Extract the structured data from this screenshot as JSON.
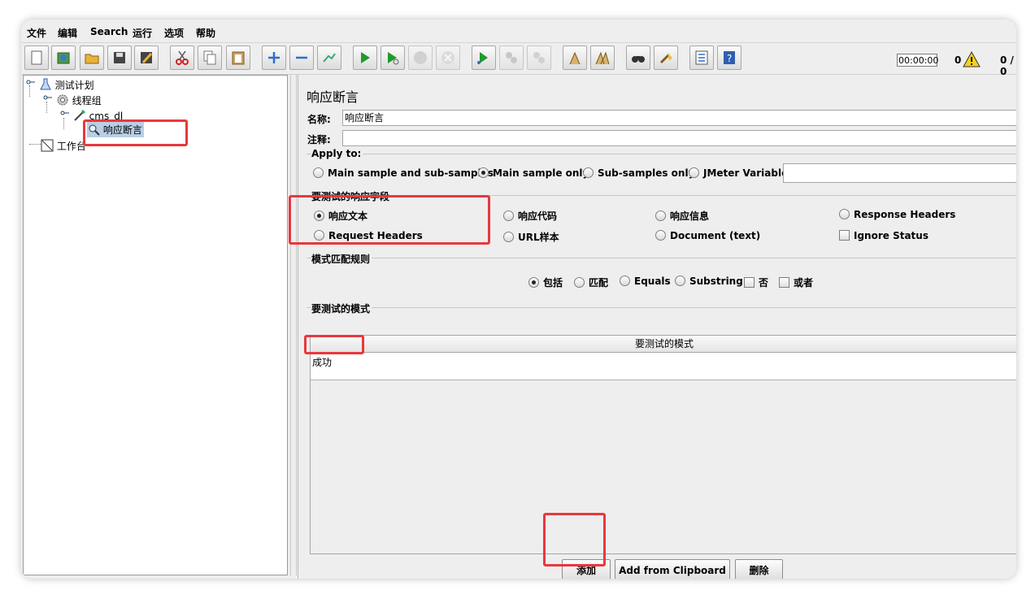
{
  "menu": [
    "文件",
    "编辑",
    "Search",
    "运行",
    "选项",
    "帮助"
  ],
  "toolbar": {
    "icons": [
      "new-icon",
      "templates-icon",
      "open-icon",
      "save-icon",
      "save-as-icon",
      "cut-icon",
      "copy-icon",
      "paste-icon",
      "expand-icon",
      "collapse-icon",
      "toggle-icon",
      "start-icon",
      "start-no-pause-icon",
      "stop-icon",
      "shutdown-icon",
      "remote-start-icon",
      "remote-stop-icon",
      "remote-shutdown-icon",
      "clear-icon",
      "clear-all-icon",
      "search-icon",
      "reset-search-icon",
      "function-helper-icon",
      "help-icon"
    ],
    "timer": "00:00:00",
    "error_count": "0",
    "thread_ratio": "0 / 0"
  },
  "tree": {
    "test_plan": "测试计划",
    "thread_group": "线程组",
    "sampler": "cms_dl",
    "assertion": "响应断言",
    "workbench": "工作台"
  },
  "panel": {
    "title": "响应断言",
    "name_label": "名称:",
    "name_value": "响应断言",
    "comment_label": "注释:",
    "comment_value": "",
    "apply_to": {
      "title": "Apply to:",
      "options": [
        "Main sample and sub-samples",
        "Main sample only",
        "Sub-samples only",
        "JMeter Variable"
      ],
      "selected": "Main sample only",
      "variable_value": ""
    },
    "field_to_test": {
      "title": "要测试的响应字段",
      "options": [
        "响应文本",
        "响应代码",
        "响应信息",
        "Response Headers",
        "Request Headers",
        "URL样本",
        "Document (text)"
      ],
      "selected": "响应文本",
      "ignore_status": "Ignore Status"
    },
    "matching_rules": {
      "title": "模式匹配规则",
      "options": [
        "包括",
        "匹配",
        "Equals",
        "Substring"
      ],
      "selected": "包括",
      "checkboxes": [
        "否",
        "或者"
      ]
    },
    "patterns": {
      "title": "要测试的模式",
      "column": "要测试的模式",
      "rows": [
        "成功"
      ]
    },
    "buttons": {
      "add": "添加",
      "add_clipboard": "Add from Clipboard",
      "delete": "删除"
    }
  },
  "colors": {
    "highlight": "#e8383d",
    "selection": "#b8cfe5"
  }
}
